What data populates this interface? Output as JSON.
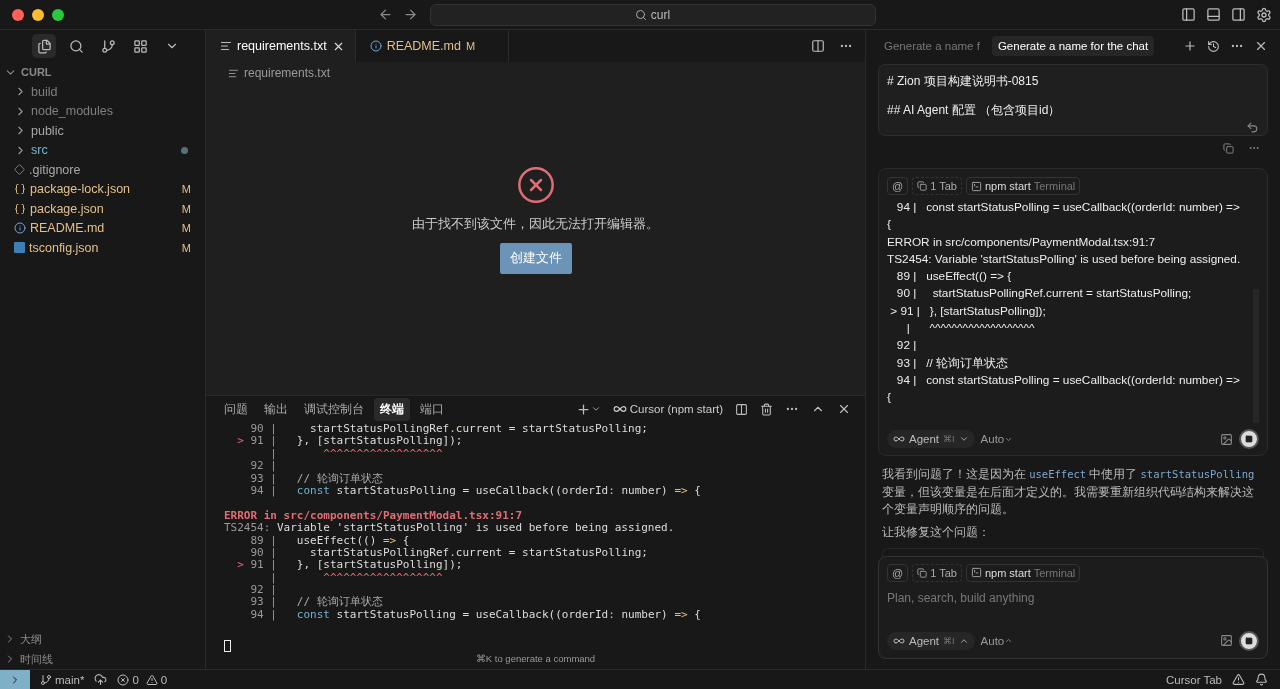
{
  "title_bar": {
    "search": "curl"
  },
  "sidebar": {
    "section": "CURL",
    "expanded": true,
    "items": [
      {
        "kind": "folder",
        "label": "build",
        "color": "#7f7f7f"
      },
      {
        "kind": "folder",
        "label": "node_modules",
        "color": "#7f7f7f"
      },
      {
        "kind": "folder",
        "label": "public",
        "color": "#a8a8a8"
      },
      {
        "kind": "folder",
        "label": "src",
        "color": "#73b8d4",
        "dot": true
      },
      {
        "kind": "git",
        "label": ".gitignore",
        "color": "#a8a8a8"
      },
      {
        "kind": "json",
        "label": "package-lock.json",
        "color": "#e2c08d",
        "badge": "M"
      },
      {
        "kind": "json",
        "label": "package.json",
        "color": "#e2c08d",
        "badge": "M"
      },
      {
        "kind": "info",
        "label": "README.md",
        "color": "#e2c08d",
        "badge": "M"
      },
      {
        "kind": "typescript",
        "label": "tsconfig.json",
        "color": "#e2c08d",
        "badge": "M"
      }
    ],
    "bottom_sections": [
      "大纲",
      "时间线"
    ]
  },
  "editor": {
    "tabs": [
      {
        "kind": "text",
        "label": "requirements.txt",
        "selected": true
      },
      {
        "kind": "info",
        "label": "README.md",
        "badge": "M",
        "selected": false
      }
    ],
    "breadcrumb": "requirements.txt",
    "message": "由于找不到该文件，因此无法打开编辑器。",
    "button": "创建文件"
  },
  "panel": {
    "tabs": [
      {
        "label": "问题",
        "selected": false
      },
      {
        "label": "输出",
        "selected": false
      },
      {
        "label": "调试控制台",
        "selected": false
      },
      {
        "label": "终端",
        "selected": true
      },
      {
        "label": "端口",
        "selected": false
      }
    ],
    "terminal_name": "Cursor (npm start)",
    "lines": [
      {
        "kind": "code",
        "gutter": "90 |",
        "segments": [
          {
            "kind": "plain",
            "text": "    startStatusPollingRef"
          },
          {
            "kind": "op",
            "text": "."
          },
          {
            "kind": "plain",
            "text": "current = startStatusPolling;"
          }
        ]
      },
      {
        "kind": "code",
        "marker": ">",
        "gutter": "91 |",
        "segments": [
          {
            "kind": "plain",
            "text": "  }, [startStatusPolling]);"
          }
        ]
      },
      {
        "kind": "code",
        "gutter": "|",
        "segments": [
          {
            "kind": "squiggle",
            "text": "      ^^^^^^^^^^^^^^^^^^"
          }
        ]
      },
      {
        "kind": "code",
        "gutter": "92 |"
      },
      {
        "kind": "code",
        "gutter": "93 |",
        "segments": [
          {
            "kind": "comment",
            "text": "  // 轮询订单状态"
          }
        ]
      },
      {
        "kind": "code",
        "gutter": "94 |",
        "segments": [
          {
            "kind": "keyword",
            "text": "  const"
          },
          {
            "kind": "plain",
            "text": " startStatusPolling = useCallback((orderId"
          },
          {
            "kind": "op",
            "text": ":"
          },
          {
            "kind": "plain",
            "text": " number) "
          },
          {
            "kind": "op",
            "text": "=>"
          },
          {
            "kind": "plain",
            "text": " {"
          }
        ]
      },
      {
        "kind": "blank"
      },
      {
        "kind": "plain",
        "segments": [
          {
            "kind": "error",
            "text": "ERROR in src/components/PaymentModal.tsx:91:7"
          }
        ]
      },
      {
        "kind": "plain",
        "segments": [
          {
            "kind": "dim",
            "text": "TS2454:"
          },
          {
            "kind": "plain",
            "text": " Variable 'startStatusPolling' is used before being assigned."
          }
        ]
      },
      {
        "kind": "code",
        "gutter": "89 |",
        "segments": [
          {
            "kind": "plain",
            "text": "  useEffect(() "
          },
          {
            "kind": "op",
            "text": "=>"
          },
          {
            "kind": "plain",
            "text": " {"
          }
        ]
      },
      {
        "kind": "code",
        "gutter": "90 |",
        "segments": [
          {
            "kind": "plain",
            "text": "    startStatusPollingRef"
          },
          {
            "kind": "op",
            "text": "."
          },
          {
            "kind": "plain",
            "text": "current = startStatusPolling;"
          }
        ]
      },
      {
        "kind": "code",
        "marker": ">",
        "gutter": "91 |",
        "segments": [
          {
            "kind": "plain",
            "text": "  }, [startStatusPolling]);"
          }
        ]
      },
      {
        "kind": "code",
        "gutter": "|",
        "segments": [
          {
            "kind": "squiggle",
            "text": "      ^^^^^^^^^^^^^^^^^^"
          }
        ]
      },
      {
        "kind": "code",
        "gutter": "92 |"
      },
      {
        "kind": "code",
        "gutter": "93 |",
        "segments": [
          {
            "kind": "comment",
            "text": "  // 轮询订单状态"
          }
        ]
      },
      {
        "kind": "code",
        "gutter": "94 |",
        "segments": [
          {
            "kind": "keyword",
            "text": "  const"
          },
          {
            "kind": "plain",
            "text": " startStatusPolling = useCallback((orderId"
          },
          {
            "kind": "op",
            "text": ":"
          },
          {
            "kind": "plain",
            "text": " number) "
          },
          {
            "kind": "op",
            "text": "=>"
          },
          {
            "kind": "plain",
            "text": " {"
          }
        ]
      },
      {
        "kind": "blank"
      },
      {
        "kind": "cursor"
      }
    ],
    "hint": "⌘K to generate a command"
  },
  "chat": {
    "tabs": [
      {
        "label": "Generate a name f",
        "selected": false
      },
      {
        "label": "Generate a name for the chat",
        "selected": true
      }
    ],
    "user_message": [
      "# Zion 项目构建说明书-0815",
      "## AI Agent 配置 （包含项目id）"
    ],
    "chips": [
      {
        "kind": "at",
        "label": "@"
      },
      {
        "kind": "tab",
        "label": "1 Tab"
      },
      {
        "kind": "terminal",
        "label": "npm start",
        "detail": "Terminal"
      }
    ],
    "context_lines": [
      "   94 |   const startStatusPolling = useCallback((orderId: number) =>",
      "{",
      "ERROR in src/components/PaymentModal.tsx:91:7",
      "TS2454: Variable 'startStatusPolling' is used before being assigned.",
      "   89 |   useEffect(() => {",
      "   90 |     startStatusPollingRef.current = startStatusPolling;",
      " > 91 |   }, [startStatusPolling]);",
      "      |      ^^^^^^^^^^^^^^^^^^^",
      "   92 |",
      "   93 |   // 轮询订单状态",
      "   94 |   const startStatusPolling = useCallback((orderId: number) =>",
      "{"
    ],
    "mode": {
      "label": "Agent",
      "shortcut": "⌘I",
      "model": "Auto"
    },
    "reply": [
      {
        "kind": "text",
        "text": "我看到问题了！这是因为在 "
      },
      {
        "kind": "code",
        "text": "useEffect"
      },
      {
        "kind": "text",
        "text": " 中使用了 "
      },
      {
        "kind": "code",
        "text": "startStatusPolling"
      },
      {
        "kind": "text",
        "text": " 变量，但该变量是在后面才定义的。我需要重新组织代码结构来解决这个变量声明顺序的问题。"
      }
    ],
    "reply_2": "让我修复这个问题：",
    "input": {
      "chips": [
        {
          "kind": "at",
          "label": "@"
        },
        {
          "kind": "tab",
          "label": "1 Tab"
        },
        {
          "kind": "terminal",
          "label": "npm start",
          "detail": "Terminal"
        }
      ],
      "placeholder": "Plan, search, build anything",
      "mode": {
        "label": "Agent",
        "shortcut": "⌘I",
        "model": "Auto"
      }
    }
  },
  "status_bar": {
    "branch": "main*",
    "errors": "0",
    "warnings": "0",
    "right": "Cursor Tab"
  }
}
